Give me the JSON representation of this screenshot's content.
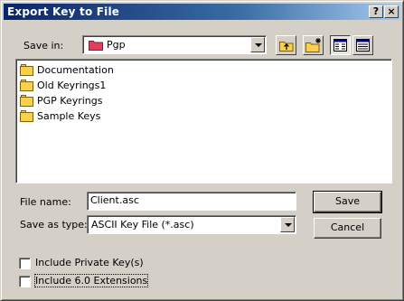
{
  "window": {
    "title": "Export Key to File",
    "help_btn": "?",
    "close_btn": "×"
  },
  "save_in": {
    "label": "Save in:",
    "value": "Pgp"
  },
  "files": [
    {
      "name": "Documentation"
    },
    {
      "name": "Old Keyrings1"
    },
    {
      "name": "PGP Keyrings"
    },
    {
      "name": "Sample Keys"
    }
  ],
  "file_name": {
    "label": "File name:",
    "value": "Client.asc"
  },
  "save_as_type": {
    "label": "Save as type:",
    "value": "ASCII Key File (*.asc)"
  },
  "buttons": {
    "save": "Save",
    "cancel": "Cancel"
  },
  "options": {
    "include_private": {
      "label": "Include Private Key(s)",
      "checked": false
    },
    "include_60": {
      "label": "Include 6.0 Extensions",
      "checked": false
    }
  },
  "icons": {
    "up_folder": "up-one-level-icon",
    "new_folder": "create-new-folder-icon",
    "list_view": "list-view-icon",
    "details_view": "details-view-icon"
  }
}
